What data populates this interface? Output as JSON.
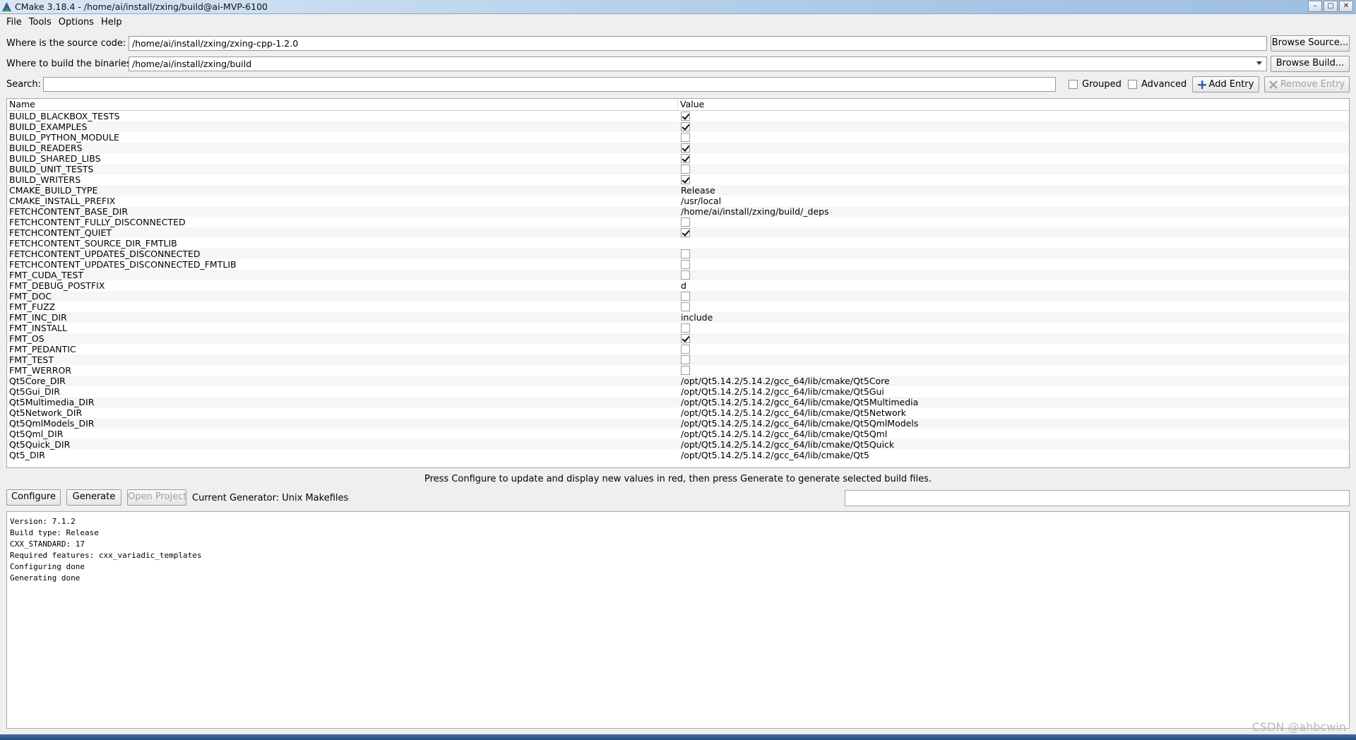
{
  "window": {
    "title": "CMake 3.18.4 - /home/ai/install/zxing/build@ai-MVP-6100",
    "controls": [
      "–",
      "□",
      "✕"
    ]
  },
  "menu": [
    {
      "label": "File"
    },
    {
      "label": "Tools"
    },
    {
      "label": "Options"
    },
    {
      "label": "Help"
    }
  ],
  "source": {
    "label": "Where is the source code:",
    "value": "/home/ai/install/zxing/zxing-cpp-1.2.0",
    "browse_label": "Browse Source..."
  },
  "build": {
    "label": "Where to build the binaries:",
    "value": "/home/ai/install/zxing/build",
    "browse_label": "Browse Build..."
  },
  "search": {
    "label": "Search:",
    "value": ""
  },
  "options": {
    "grouped_label": "Grouped",
    "advanced_label": "Advanced",
    "add_entry_label": "Add Entry",
    "remove_entry_label": "Remove Entry"
  },
  "table": {
    "columns": [
      "Name",
      "Value"
    ],
    "rows": [
      {
        "name": "BUILD_BLACKBOX_TESTS",
        "type": "bool",
        "checked": true
      },
      {
        "name": "BUILD_EXAMPLES",
        "type": "bool",
        "checked": true
      },
      {
        "name": "BUILD_PYTHON_MODULE",
        "type": "bool",
        "checked": false
      },
      {
        "name": "BUILD_READERS",
        "type": "bool",
        "checked": true
      },
      {
        "name": "BUILD_SHARED_LIBS",
        "type": "bool",
        "checked": true
      },
      {
        "name": "BUILD_UNIT_TESTS",
        "type": "bool",
        "checked": false
      },
      {
        "name": "BUILD_WRITERS",
        "type": "bool",
        "checked": true
      },
      {
        "name": "CMAKE_BUILD_TYPE",
        "type": "text",
        "value": "Release"
      },
      {
        "name": "CMAKE_INSTALL_PREFIX",
        "type": "text",
        "value": "/usr/local"
      },
      {
        "name": "FETCHCONTENT_BASE_DIR",
        "type": "text",
        "value": "/home/ai/install/zxing/build/_deps"
      },
      {
        "name": "FETCHCONTENT_FULLY_DISCONNECTED",
        "type": "bool",
        "checked": false
      },
      {
        "name": "FETCHCONTENT_QUIET",
        "type": "bool",
        "checked": true
      },
      {
        "name": "FETCHCONTENT_SOURCE_DIR_FMTLIB",
        "type": "text",
        "value": ""
      },
      {
        "name": "FETCHCONTENT_UPDATES_DISCONNECTED",
        "type": "bool",
        "checked": false
      },
      {
        "name": "FETCHCONTENT_UPDATES_DISCONNECTED_FMTLIB",
        "type": "bool",
        "checked": false
      },
      {
        "name": "FMT_CUDA_TEST",
        "type": "bool",
        "checked": false
      },
      {
        "name": "FMT_DEBUG_POSTFIX",
        "type": "text",
        "value": "d"
      },
      {
        "name": "FMT_DOC",
        "type": "bool",
        "checked": false
      },
      {
        "name": "FMT_FUZZ",
        "type": "bool",
        "checked": false
      },
      {
        "name": "FMT_INC_DIR",
        "type": "text",
        "value": "include"
      },
      {
        "name": "FMT_INSTALL",
        "type": "bool",
        "checked": false
      },
      {
        "name": "FMT_OS",
        "type": "bool",
        "checked": true
      },
      {
        "name": "FMT_PEDANTIC",
        "type": "bool",
        "checked": false
      },
      {
        "name": "FMT_TEST",
        "type": "bool",
        "checked": false
      },
      {
        "name": "FMT_WERROR",
        "type": "bool",
        "checked": false
      },
      {
        "name": "Qt5Core_DIR",
        "type": "text",
        "value": "/opt/Qt5.14.2/5.14.2/gcc_64/lib/cmake/Qt5Core"
      },
      {
        "name": "Qt5Gui_DIR",
        "type": "text",
        "value": "/opt/Qt5.14.2/5.14.2/gcc_64/lib/cmake/Qt5Gui"
      },
      {
        "name": "Qt5Multimedia_DIR",
        "type": "text",
        "value": "/opt/Qt5.14.2/5.14.2/gcc_64/lib/cmake/Qt5Multimedia"
      },
      {
        "name": "Qt5Network_DIR",
        "type": "text",
        "value": "/opt/Qt5.14.2/5.14.2/gcc_64/lib/cmake/Qt5Network"
      },
      {
        "name": "Qt5QmlModels_DIR",
        "type": "text",
        "value": "/opt/Qt5.14.2/5.14.2/gcc_64/lib/cmake/Qt5QmlModels"
      },
      {
        "name": "Qt5Qml_DIR",
        "type": "text",
        "value": "/opt/Qt5.14.2/5.14.2/gcc_64/lib/cmake/Qt5Qml"
      },
      {
        "name": "Qt5Quick_DIR",
        "type": "text",
        "value": "/opt/Qt5.14.2/5.14.2/gcc_64/lib/cmake/Qt5Quick"
      },
      {
        "name": "Qt5_DIR",
        "type": "text",
        "value": "/opt/Qt5.14.2/5.14.2/gcc_64/lib/cmake/Qt5"
      }
    ]
  },
  "hint": "Press Configure to update and display new values in red, then press Generate to generate selected build files.",
  "actions": {
    "configure_label": "Configure",
    "generate_label": "Generate",
    "open_project_label": "Open Project",
    "generator_text": "Current Generator: Unix Makefiles"
  },
  "output_lines": [
    "Version: 7.1.2",
    "Build type: Release",
    "CXX_STANDARD: 17",
    "Required features: cxx_variadic_templates",
    "Configuring done",
    "Generating done"
  ],
  "watermark": "CSDN @ahbcwin",
  "colors": {
    "titlebar": "#bcd4ec",
    "window_bg": "#efefef",
    "add_entry_icon": "#2b5fb5"
  }
}
